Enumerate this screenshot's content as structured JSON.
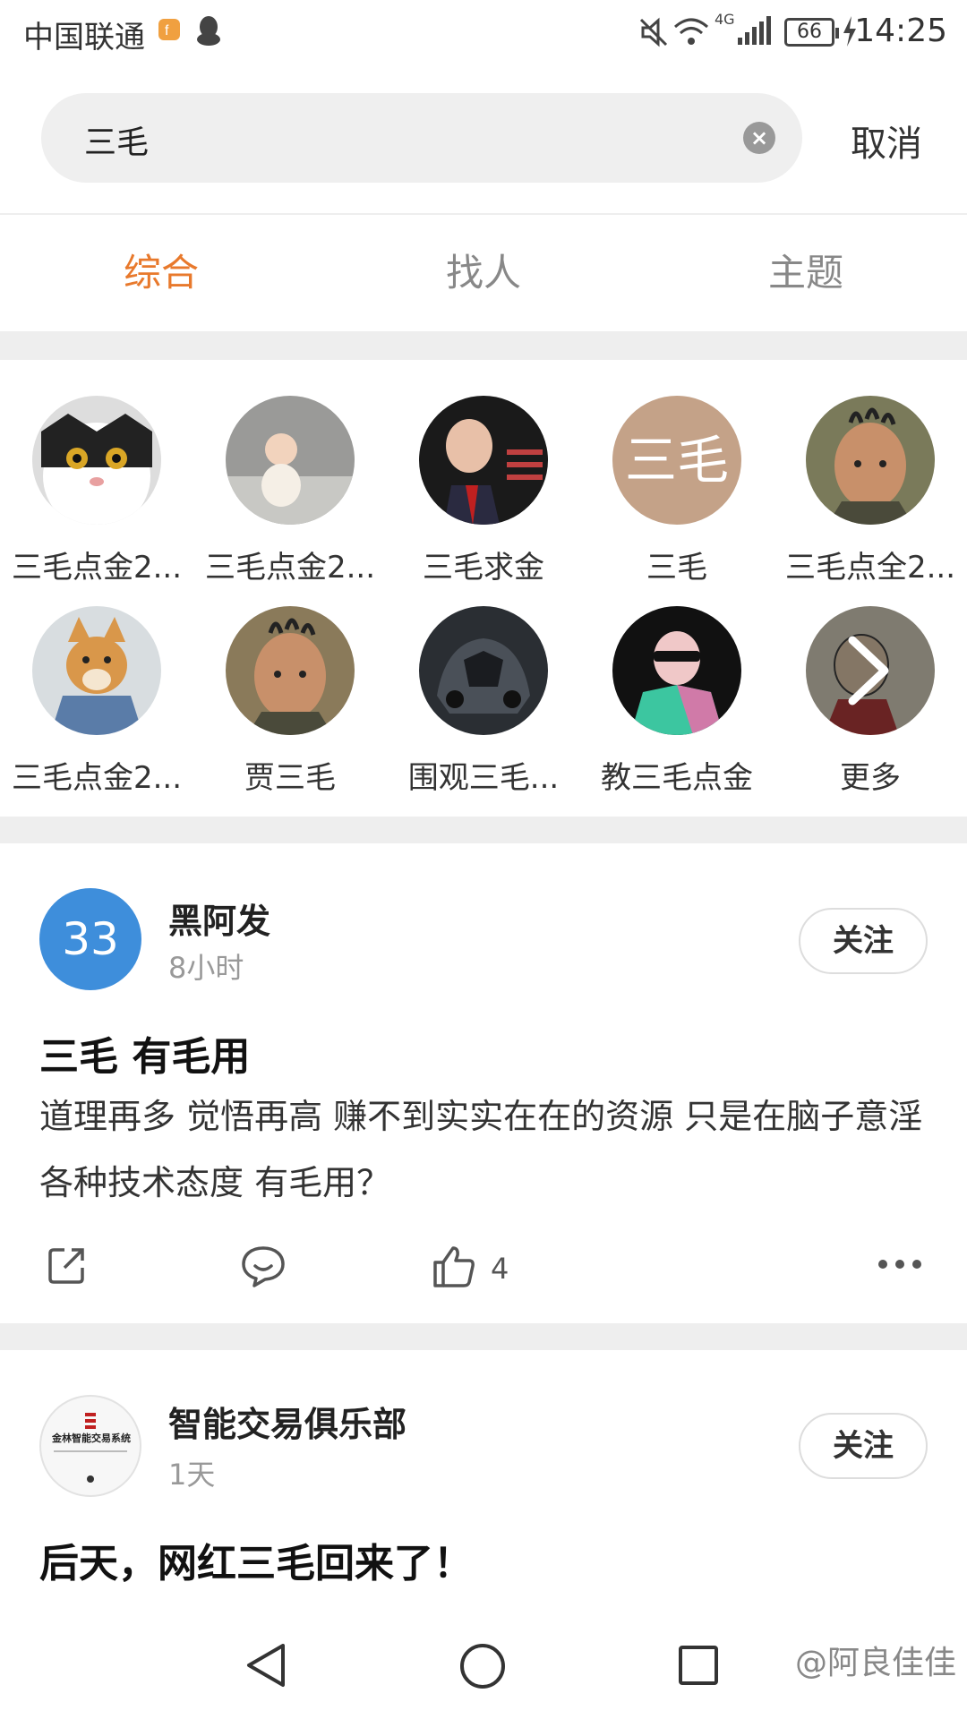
{
  "status_bar": {
    "carrier": "中国联通",
    "battery": "66",
    "time": "14:25",
    "network": "4G"
  },
  "search": {
    "value": "三毛",
    "cancel_label": "取消"
  },
  "tabs": [
    {
      "label": "综合",
      "active": true
    },
    {
      "label": "找人",
      "active": false
    },
    {
      "label": "主题",
      "active": false
    }
  ],
  "users": [
    {
      "name": "三毛点金2...",
      "avatar": "cat-photo"
    },
    {
      "name": "三毛点金2...",
      "avatar": "baby-photo"
    },
    {
      "name": "三毛求金",
      "avatar": "old-man-photo"
    },
    {
      "name": "三毛",
      "avatar_text": "三毛"
    },
    {
      "name": "三毛点全2...",
      "avatar": "boy-photo"
    },
    {
      "name": "三毛点金2...",
      "avatar": "dog-photo"
    },
    {
      "name": "贾三毛",
      "avatar": "boy-photo"
    },
    {
      "name": "围观三毛...",
      "avatar": "car-photo"
    },
    {
      "name": "教三毛点金",
      "avatar": "sunglasses-photo"
    },
    {
      "name": "更多",
      "avatar": "cartoon-photo"
    }
  ],
  "posts": [
    {
      "avatar_text": "33",
      "author": "黑阿发",
      "time": "8小时",
      "follow_label": "关注",
      "title": "三毛 有毛用",
      "body": "道理再多 觉悟再高 赚不到实实在在的资源 只是在脑子意淫各种技术态度 有毛用？",
      "likes": "4"
    },
    {
      "author": "智能交易俱乐部",
      "time": "1天",
      "follow_label": "关注",
      "title": "后天，网红三毛回来了！",
      "logo_text": "金林智能交易系统"
    }
  ],
  "watermark": "@阿良佳佳"
}
